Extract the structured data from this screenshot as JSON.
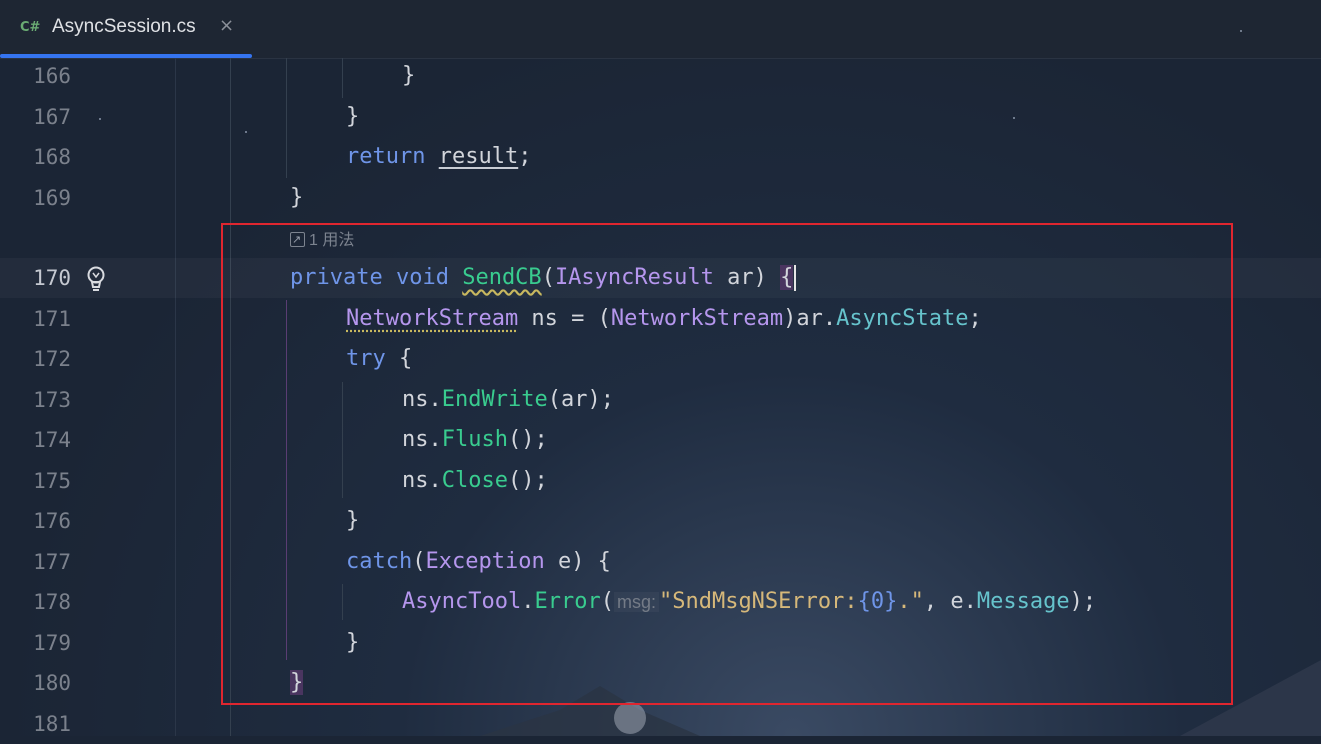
{
  "tab": {
    "lang": "C#",
    "title": "AsyncSession.cs",
    "close": "×"
  },
  "usage_hint": "1 用法",
  "lines": {
    "l166": "166",
    "l167": "167",
    "l168": "168",
    "l169": "169",
    "l170": "170",
    "l171": "171",
    "l172": "172",
    "l173": "173",
    "l174": "174",
    "l175": "175",
    "l176": "176",
    "l177": "177",
    "l178": "178",
    "l179": "179",
    "l180": "180",
    "l181": "181"
  },
  "code": {
    "c166": "}",
    "c167": "}",
    "c168_kw": "return",
    "c168_var": "result",
    "c168_end": ";",
    "c169": "}",
    "c170_private": "private",
    "c170_void": "void",
    "c170_method": "SendCB",
    "c170_open": "(",
    "c170_type": "IAsyncResult",
    "c170_param": " ar) ",
    "c170_brace": "{",
    "c171_type1": "NetworkStream",
    "c171_mid": " ns = (",
    "c171_type2": "NetworkStream",
    "c171_ar": ")ar.",
    "c171_prop": "AsyncState",
    "c171_end": ";",
    "c172_kw": "try",
    "c172_brace": " {",
    "c173_ns": "ns.",
    "c173_method": "EndWrite",
    "c173_end": "(ar);",
    "c174_ns": "ns.",
    "c174_method": "Flush",
    "c174_end": "();",
    "c175_ns": "ns.",
    "c175_method": "Close",
    "c175_end": "();",
    "c176": "}",
    "c177_kw": "catch",
    "c177_open": "(",
    "c177_type": "Exception",
    "c177_end": " e) {",
    "c178_type": "AsyncTool",
    "c178_dot": ".",
    "c178_method": "Error",
    "c178_open": "(",
    "c178_hint": "msg:",
    "c178_str1": "\"SndMsgNSError:",
    "c178_fmt": "{0}",
    "c178_str2": ".\"",
    "c178_mid": ", e.",
    "c178_prop": "Message",
    "c178_end": ");",
    "c179": "}",
    "c180": "}"
  }
}
